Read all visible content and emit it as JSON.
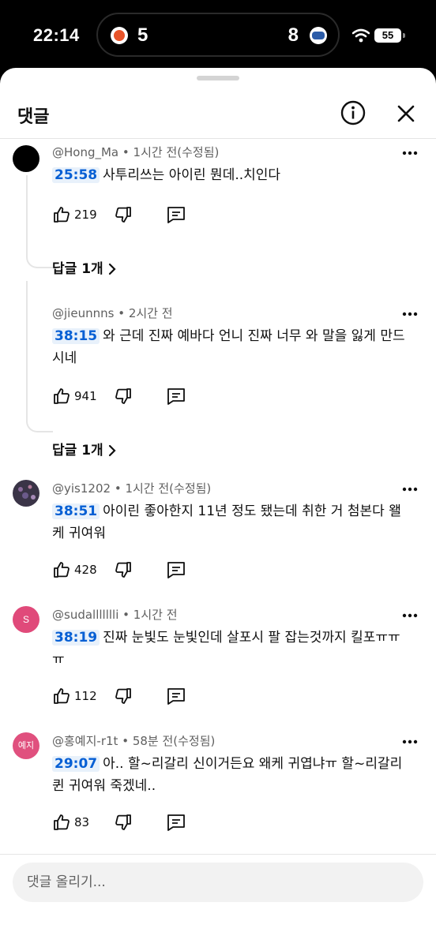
{
  "status_bar": {
    "time": "22:14",
    "left_score": "5",
    "right_score": "8",
    "battery": "55",
    "left_team_icon": "team-logo-orange",
    "right_team_icon": "team-logo-blue"
  },
  "sheet": {
    "title": "댓글",
    "info_icon": "info-icon",
    "close_icon": "close-icon"
  },
  "comments": [
    {
      "author": "@Hong_Ma",
      "meta": "1시간 전(수정됨)",
      "timestamp": "25:58",
      "text": "사투리쓰는 아이린 뭔데..치인다",
      "likes": "219",
      "replies": "답글 1개",
      "avatar_color": "#000000",
      "avatar_text": ""
    },
    {
      "author": "@jieunnns",
      "meta": "2시간 전",
      "timestamp": "38:15",
      "text": "와 근데 진짜 예바다 언니 진짜 너무 와 말을 잃게 만드시네",
      "likes": "941",
      "replies": "답글 1개",
      "avatar_color": "",
      "avatar_text": ""
    },
    {
      "author": "@yis1202",
      "meta": "1시간 전(수정됨)",
      "timestamp": "38:51",
      "text": "아이린 좋아한지 11년 정도 됐는데 취한 거 첨본다 왤케 귀여워",
      "likes": "428",
      "avatar_color": "#3a3447",
      "avatar_text": ""
    },
    {
      "author": "@sudallllllli",
      "meta": "1시간 전",
      "timestamp": "38:19",
      "text": "진짜 눈빛도 눈빛인데 살포시 팔 잡는것까지 킬포ㅠㅠㅠ",
      "likes": "112",
      "avatar_color": "#e04a7a",
      "avatar_text": "S"
    },
    {
      "author": "@홍예지-r1t",
      "meta": "58분 전(수정됨)",
      "timestamp": "29:07",
      "text": "아.. 할~리갈리 신이거든요 왜케 귀엽냐ㅠ 할~리갈리퀸 귀여워 죽겠네..",
      "likes": "83",
      "avatar_color": "#e0507e",
      "avatar_text": "예지"
    }
  ],
  "footer": {
    "placeholder": "댓글 올리기..."
  }
}
